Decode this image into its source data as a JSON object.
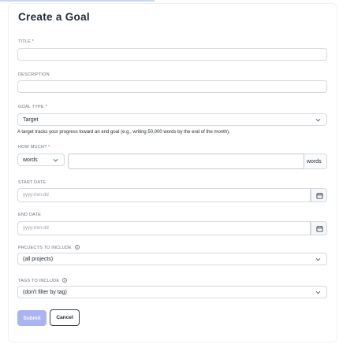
{
  "form": {
    "title": "Create a Goal",
    "title_field": {
      "label": "TITLE",
      "required_mark": "*",
      "value": ""
    },
    "description_field": {
      "label": "DESCRIPTION",
      "value": ""
    },
    "goal_type": {
      "label": "GOAL TYPE",
      "required_mark": "*",
      "selected": "Target",
      "help": "A target tracks your progress toward an end goal (e.g., writing 50,000 words by the end of the month)."
    },
    "how_much": {
      "label": "HOW MUCH?",
      "required_mark": "*",
      "unit_selected": "words",
      "value": "",
      "unit_suffix": "words"
    },
    "start_date": {
      "label": "START DATE",
      "placeholder": "yyyy-mm-dd"
    },
    "end_date": {
      "label": "END DATE",
      "placeholder": "yyyy-mm-dd"
    },
    "projects": {
      "label": "PROJECTS TO INCLUDE",
      "selected": "(all projects)"
    },
    "tags": {
      "label": "TAGS TO INCLUDE",
      "selected": "(don't filter by tag)"
    },
    "submit_label": "Submit",
    "cancel_label": "Cancel"
  },
  "icons": {
    "dropdown": "chevron-down-icon",
    "calendar": "calendar-icon",
    "info": "info-circle-icon"
  },
  "colors": {
    "submit_bg": "#aab4f3",
    "required": "#e03a3a",
    "top_accent": "#c9d8f2"
  }
}
